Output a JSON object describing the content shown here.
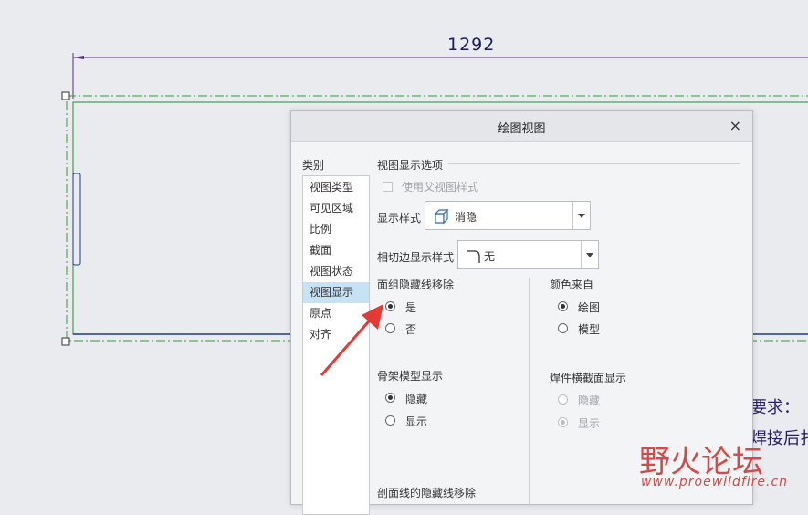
{
  "drawing": {
    "dimension": "1292",
    "note_line1": "要求：",
    "note_line2": "焊接后扌"
  },
  "dialog": {
    "title": "绘图视图",
    "close_glyph": "×",
    "category_label": "类别",
    "categories": [
      "视图类型",
      "可见区域",
      "比例",
      "截面",
      "视图状态",
      "视图显示",
      "原点",
      "对齐"
    ],
    "selected_category": "视图显示",
    "section_title": "视图显示选项",
    "use_parent_style_label": "使用父视图样式",
    "display_style_label": "显示样式",
    "display_style_value": "消隐",
    "tangent_label": "相切边显示样式",
    "tangent_value": "无",
    "face_group_label": "面组隐藏线移除",
    "face_group_yes": "是",
    "face_group_no": "否",
    "color_source_label": "颜色来自",
    "color_drawing": "绘图",
    "color_model": "模型",
    "skeleton_label": "骨架模型显示",
    "skeleton_hide": "隐藏",
    "skeleton_show": "显示",
    "weld_label": "焊件横截面显示",
    "weld_hide": "隐藏",
    "weld_show": "显示",
    "section_hidden_label": "剖面线的隐藏线移除"
  },
  "watermark": {
    "logo_text": "野火论坛",
    "url": "www.proewildfire.cn"
  },
  "colors": {
    "accent_selected": "#c7e2f5",
    "annotation_arrow": "#e53935"
  }
}
